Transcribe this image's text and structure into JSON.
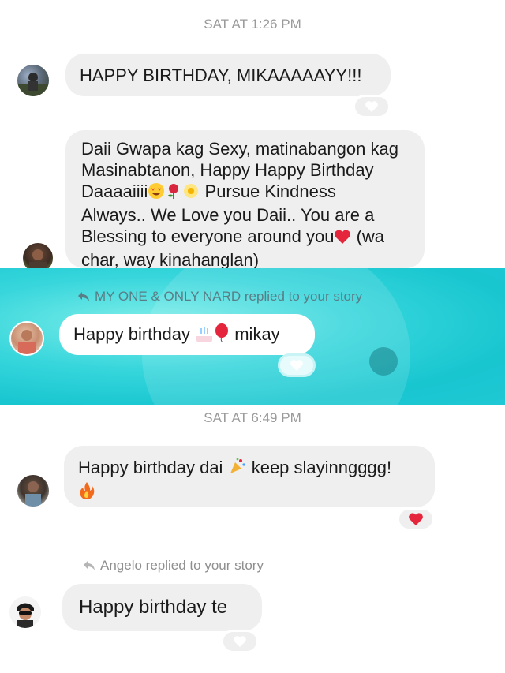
{
  "messages": {
    "ts1": "SAT AT 1:26 PM",
    "m1": "HAPPY BIRTHDAY, MIKAAAAAYY!!!",
    "m2_l1": "Daii Gwapa kag Sexy, matinabangon kag",
    "m2_l2": "Masinabtanon,  Happy Happy Birthday",
    "m2_l3a": "Daaaaiiii",
    "m2_l3b": "Pursue Kindness",
    "m2_l4": "Always.. We Love you Daii.. You are a",
    "m2_l5a": "Blessing to everyone around you",
    "m2_l5b": "(wa",
    "m2_l6": "char, way kinahanglan)",
    "story1_label": "MY ONE & ONLY NARD replied to your story",
    "story1_msg_a": "Happy birthday",
    "story1_msg_b": "mikay",
    "ts2": "SAT AT 6:49 PM",
    "m3_l1a": "Happy birthday dai",
    "m3_l1b": "keep slayinngggg!",
    "story2_label": "Angelo replied to your story",
    "story2_msg": "Happy birthday te"
  },
  "icons": {
    "reply": "reply-arrow-icon",
    "heart": "heart-icon",
    "reaction_empty": "reaction-placeholder-icon"
  },
  "colors": {
    "bubble": "#efefef",
    "timestamp": "#9a9a9a",
    "story_bg": "#1fc8d4",
    "heart": "#e4253b"
  }
}
